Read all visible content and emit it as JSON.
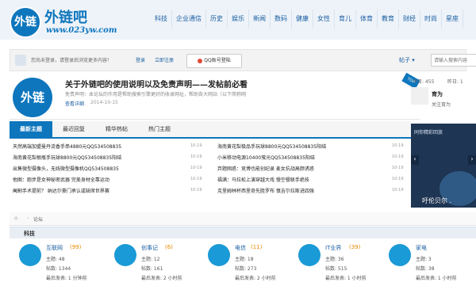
{
  "header": {
    "logo_badge": "外链",
    "logo_title": "外链吧",
    "logo_url": "www.023yw.com",
    "nav": [
      "科技",
      "企业通信",
      "历史",
      "娱乐",
      "新闻",
      "数码",
      "健康",
      "女性",
      "育儿",
      "体育",
      "教育",
      "财经",
      "时尚",
      "星座"
    ]
  },
  "loginbar": {
    "tip": "您尚未登录，请登录后浏览更多内容！",
    "login": "登录",
    "register": "立即注册",
    "qq_label": "QQ账号登陆",
    "user_menu": "帖子 ▾",
    "search_placeholder": "请输入搜索内容"
  },
  "notice": {
    "logo": "外链",
    "title": "关于外链吧的使用说明以及免责声明——发帖前必看",
    "desc": "免责声明：本论坛的作用是帮助搜索引擎更好的收录网址，帮助各大网站（以下简称网",
    "more": "查看详细",
    "date": "2014-10-15",
    "ribbon": "TOP"
  },
  "right": {
    "stat_today": "今日: 455",
    "stat_yesterday": "昨日: 1",
    "title": "育为",
    "follow": "关注育为"
  },
  "tabs": [
    "最新主题",
    "最近回复",
    "精华热帖",
    "热门主题"
  ],
  "threads": {
    "left": [
      {
        "title": "天然高端加盟曼丹流香手串4880元QQ534508835",
        "date": "10-19"
      },
      {
        "title": "海南黄花梨根瓶手玩球8800元QQ534508835阳结",
        "date": "10-19"
      },
      {
        "title": "出售微型摄像头，无线微型摄像机QQ534508835",
        "date": "10-19"
      },
      {
        "title": "他图：跑步是女神秘密武器 完美身材全靠运动",
        "date": "10-19"
      },
      {
        "title": "阉割手术提前？ 纳达尔豪门承认或缺席世界赛",
        "date": "10-19"
      }
    ],
    "right": [
      {
        "title": "海南黄花梨极品手玩球8800元QQ534508835阳结",
        "date": "10-19"
      },
      {
        "title": "小米移动电源10400萤光QQ534508835阳结",
        "date": "10-19"
      },
      {
        "title": "弃题困惑：竞博也能创纪录 麦女抗战高颜诱惑",
        "date": "10-19"
      },
      {
        "title": "福满：马拉松上演穿越大戏 慢空餐联手绝技",
        "date": "10-19"
      },
      {
        "title": "克里姆林杯西里奇先胜罗布 慎吉尔拉斯进四强",
        "date": "10-19"
      }
    ]
  },
  "ad": {
    "subtitle": "同你精彩回放",
    "text": "吁伦贝尔 .",
    "prev": "‹",
    "next": "›"
  },
  "breadcrumb": {
    "home_icon": "home-icon",
    "sep": "›",
    "text": "论坛"
  },
  "category": "科技",
  "forums": [
    {
      "name": "互联网",
      "count": "(99)",
      "topics": "主题: 48",
      "posts": "帖数: 1344",
      "last": "最后发表: 1 分钟前"
    },
    {
      "name": "创事记",
      "count": "(6)",
      "topics": "主题: 12",
      "posts": "帖数: 161",
      "last": "最后发表: 2 小时前"
    },
    {
      "name": "电信",
      "count": "(11)",
      "topics": "主题: 18",
      "posts": "帖数: 273",
      "last": "最后发表: 2 小时前"
    },
    {
      "name": "IT业界",
      "count": "(39)",
      "topics": "主题: 36",
      "posts": "帖数: 515",
      "last": "最后发表: 1 小时前"
    },
    {
      "name": "家电",
      "count": "",
      "topics": "主题: 3",
      "posts": "帖数: 38",
      "last": "最后发表: 1 小时前"
    }
  ],
  "colors": {
    "brand": "#0e76bd",
    "link": "#1a5fa3",
    "count": "#e68a00"
  }
}
